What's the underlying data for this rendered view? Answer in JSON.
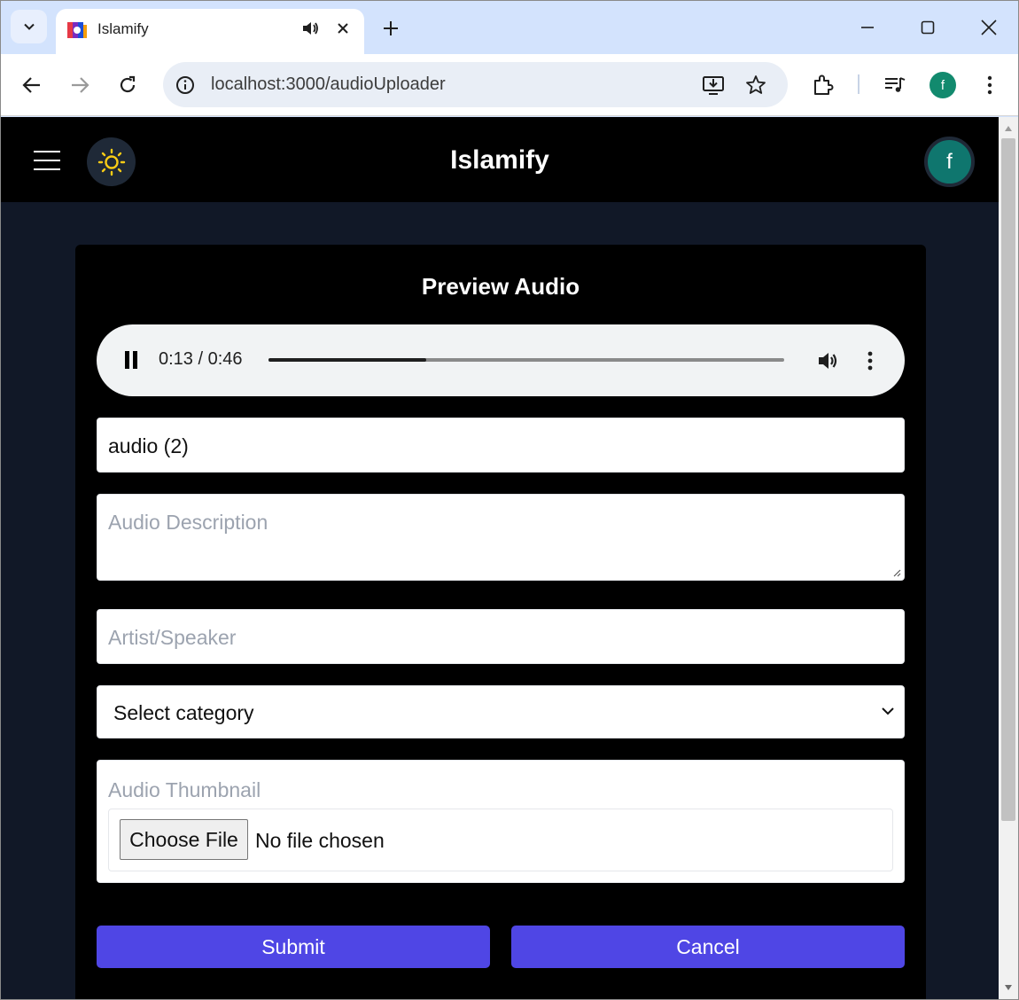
{
  "browser": {
    "tab_title": "Islamify",
    "url": "localhost:3000/audioUploader",
    "profile_initial": "f"
  },
  "app": {
    "brand": "Islamify",
    "avatar_initial": "f"
  },
  "card": {
    "title": "Preview Audio",
    "player": {
      "time": "0:13 / 0:46",
      "progress": 0.305,
      "state": "playing"
    },
    "title_input": {
      "value": "audio (2)"
    },
    "description": {
      "placeholder": "Audio Description"
    },
    "artist": {
      "placeholder": "Artist/Speaker"
    },
    "category": {
      "selected": "Select category"
    },
    "thumbnail": {
      "label": "Audio Thumbnail",
      "choose_button": "Choose File",
      "status": "No file chosen"
    },
    "submit_label": "Submit",
    "cancel_label": "Cancel"
  },
  "colors": {
    "navbar": "#000000",
    "page_bg": "#111827",
    "primary_button": "#4f46e5",
    "avatar": "#0f766e",
    "sun_icon": "#facc15"
  },
  "icons": [
    "tab-search-icon",
    "speaker-icon",
    "close-icon",
    "plus-icon",
    "minimize-icon",
    "maximize-icon",
    "back-arrow-icon",
    "forward-arrow-icon",
    "reload-icon",
    "info-icon",
    "install-app-icon",
    "star-icon",
    "extensions-icon",
    "media-controls-icon",
    "kebab-menu-icon",
    "hamburger-icon",
    "sun-icon",
    "pause-icon",
    "volume-icon",
    "chevron-down-icon"
  ]
}
